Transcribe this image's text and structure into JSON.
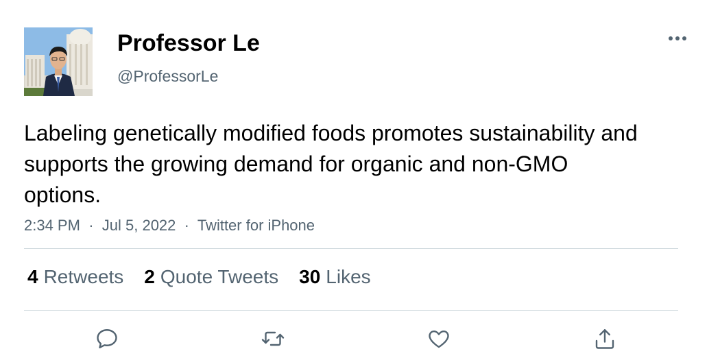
{
  "author": {
    "name": "Professor Le",
    "handle": "@ProfessorLe"
  },
  "tweet": {
    "text": "Labeling genetically modified foods promotes sustainability and supports the growing demand for organic and non-GMO options.",
    "time": "2:34 PM",
    "date": "Jul 5, 2022",
    "source": "Twitter for iPhone",
    "separator": "·"
  },
  "stats": {
    "retweets": {
      "count": "4",
      "label": "Retweets"
    },
    "quotes": {
      "count": "2",
      "label": "Quote Tweets"
    },
    "likes": {
      "count": "30",
      "label": "Likes"
    }
  },
  "icons": {
    "reply": "reply-icon",
    "retweet": "retweet-icon",
    "like": "heart-icon",
    "share": "share-icon",
    "more": "more-icon"
  },
  "colors": {
    "secondary_text": "#536471",
    "divider": "#cfd9de",
    "icon": "#536471"
  }
}
